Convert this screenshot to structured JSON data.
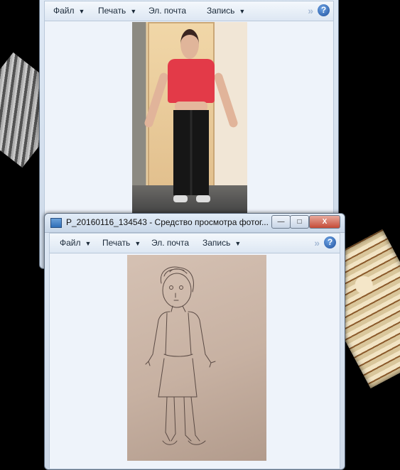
{
  "windows": [
    {
      "menu": {
        "file": "Файл",
        "print": "Печать",
        "email": "Эл. почта",
        "burn": "Запись"
      },
      "help_symbol": "?",
      "more_symbol": "»"
    },
    {
      "title": "P_20160116_134543 - Средство просмотра фотог...",
      "controls": {
        "minimize": "—",
        "maximize": "□",
        "close": "X"
      },
      "menu": {
        "file": "Файл",
        "print": "Печать",
        "email": "Эл. почта",
        "burn": "Запись"
      },
      "help_symbol": "?",
      "more_symbol": "»"
    }
  ],
  "dropdown_arrow": "▼",
  "icons": {
    "title": "photo-viewer-icon",
    "help": "help-icon",
    "more": "chevron-double-right-icon"
  }
}
